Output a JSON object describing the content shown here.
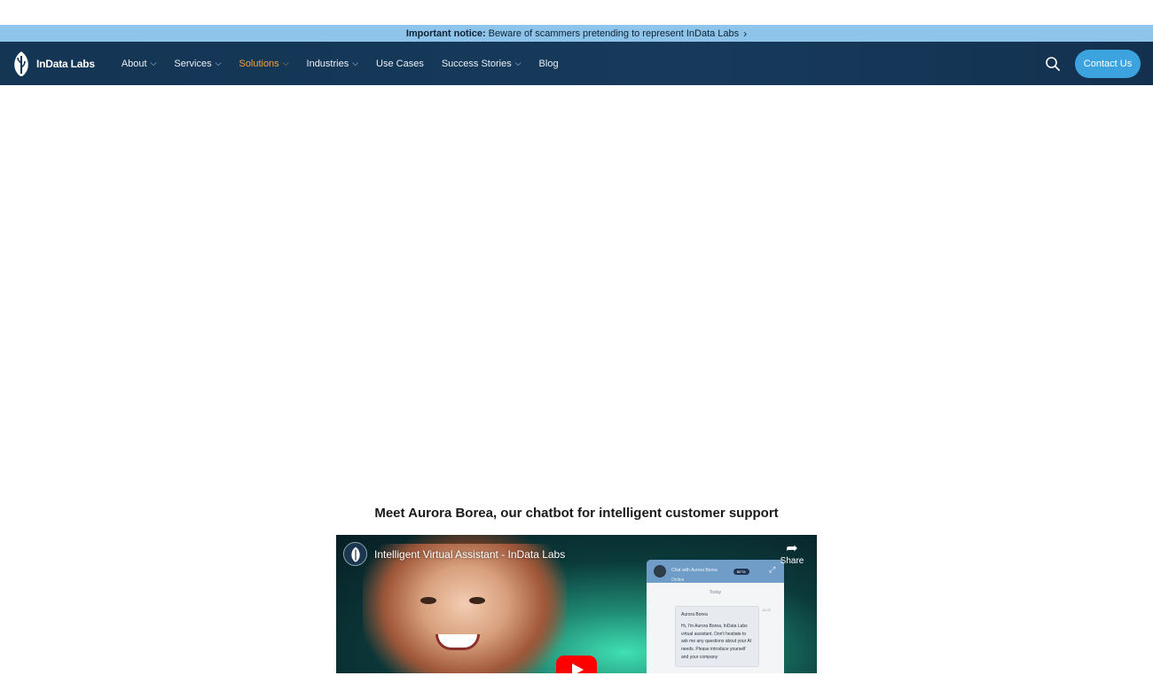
{
  "notice": {
    "label": "Important notice:",
    "text": "Beware of scammers pretending to represent InData Labs",
    "chevron_icon": "chevron-right-icon"
  },
  "header": {
    "logo_text": "InData Labs",
    "logo_icon": "indata-leaf-logo-icon",
    "menu": [
      {
        "label": "About",
        "has_dropdown": true,
        "active": false
      },
      {
        "label": "Services",
        "has_dropdown": true,
        "active": false
      },
      {
        "label": "Solutions",
        "has_dropdown": true,
        "active": true
      },
      {
        "label": "Industries",
        "has_dropdown": true,
        "active": false
      },
      {
        "label": "Use Cases",
        "has_dropdown": false,
        "active": false
      },
      {
        "label": "Success Stories",
        "has_dropdown": true,
        "active": false
      },
      {
        "label": "Blog",
        "has_dropdown": false,
        "active": false
      }
    ],
    "search_icon": "search-icon",
    "contact_label": "Contact Us"
  },
  "colors": {
    "notice_bg": "#8ec4ea",
    "nav_bg": "#143553",
    "active_menu": "#f5a23a",
    "contact_button": "#3da3df"
  },
  "main": {
    "section_title": "Meet Aurora Borea, our chatbot for intelligent customer support"
  },
  "video": {
    "title": "Intelligent Virtual Assistant - InData Labs",
    "share_label": "Share",
    "play_icon": "youtube-play-icon",
    "chat": {
      "header_title": "Chat with Aurora Borea",
      "beta_badge": "BETA",
      "status": "Online",
      "day_label": "Today",
      "time": "15:25",
      "sender": "Aurora Borea",
      "message": "Hi, I'm Aurora Borea, InData Labs virtual assistant. Don't hesitate to ask me any questions about your AI needs. Please introduce yourself and your company"
    }
  }
}
